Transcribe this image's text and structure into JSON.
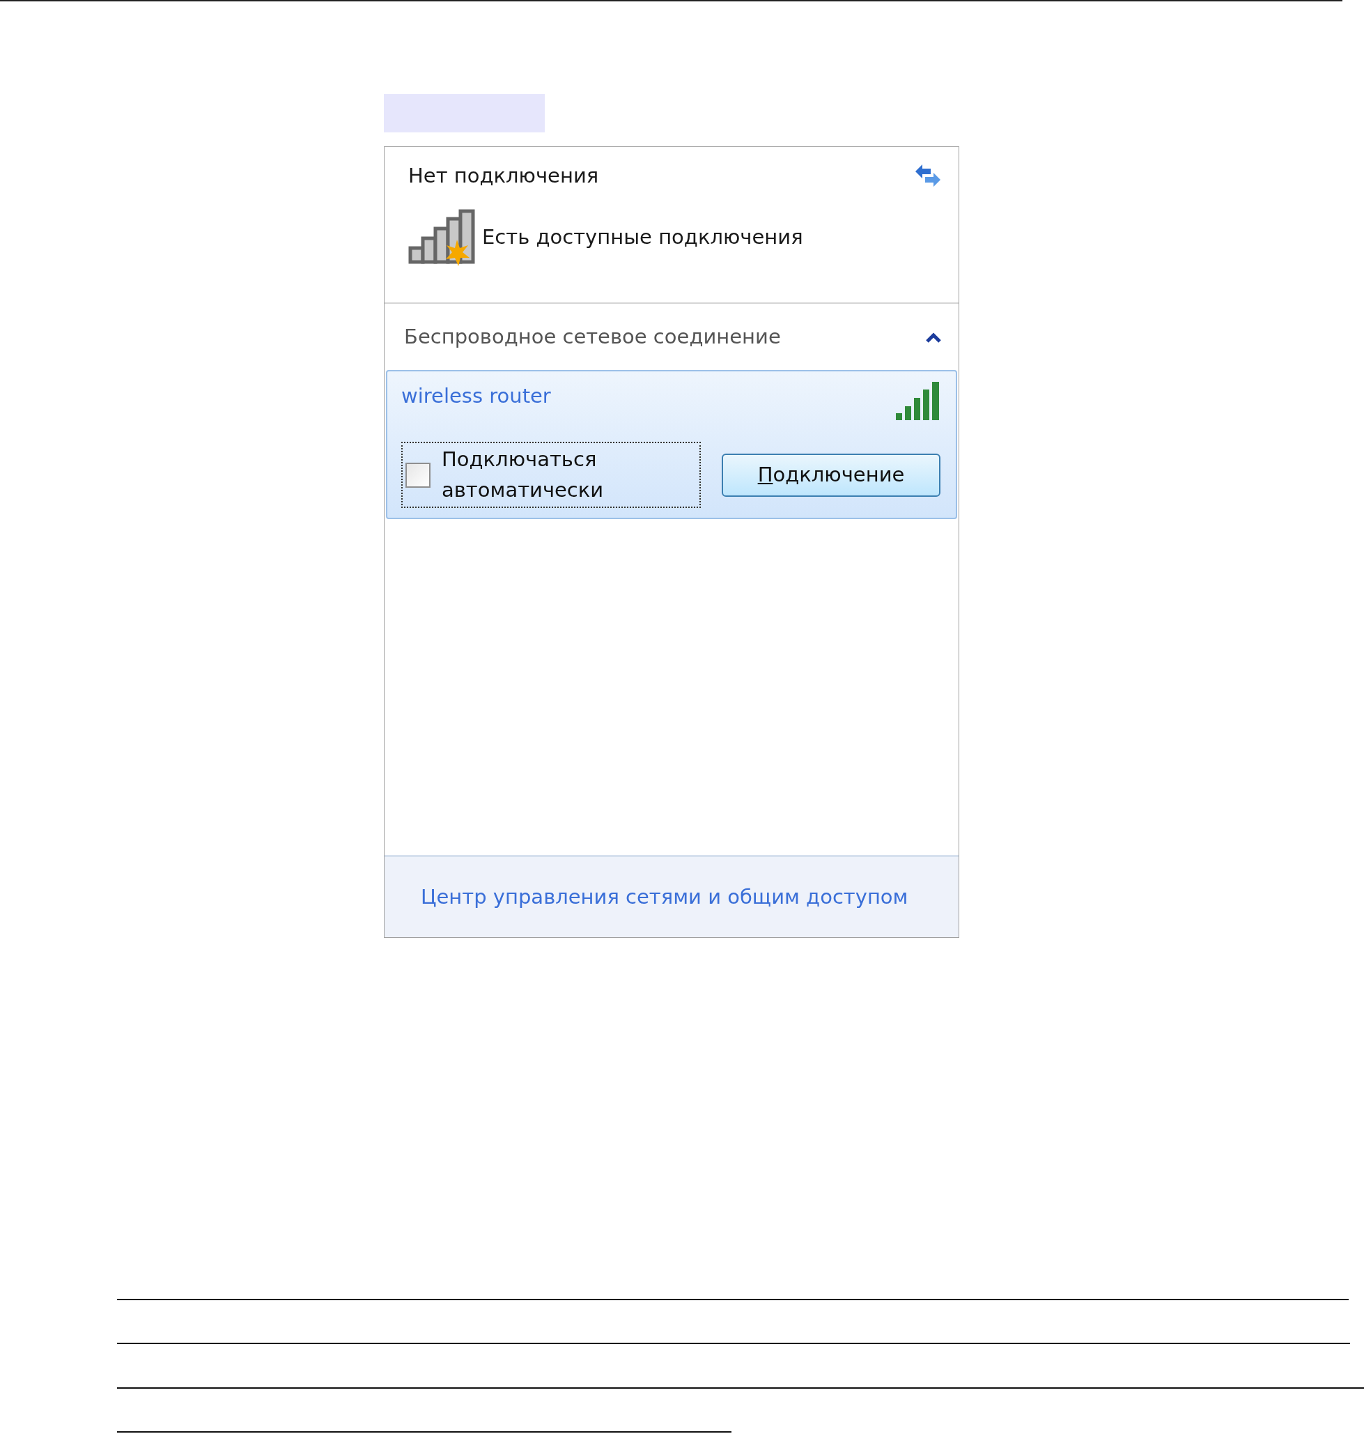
{
  "status": {
    "title": "Нет подключения",
    "available_text": "Есть доступные подключения"
  },
  "section": {
    "title": "Беспроводное сетевое соединение",
    "expanded": true
  },
  "networks": [
    {
      "name": "wireless router",
      "selected": true,
      "auto_connect": {
        "label": "Подключаться автоматически",
        "checked": false
      },
      "connect_button": "Подключение"
    }
  ],
  "footer": {
    "link": "Центр управления сетями и общим доступом"
  }
}
